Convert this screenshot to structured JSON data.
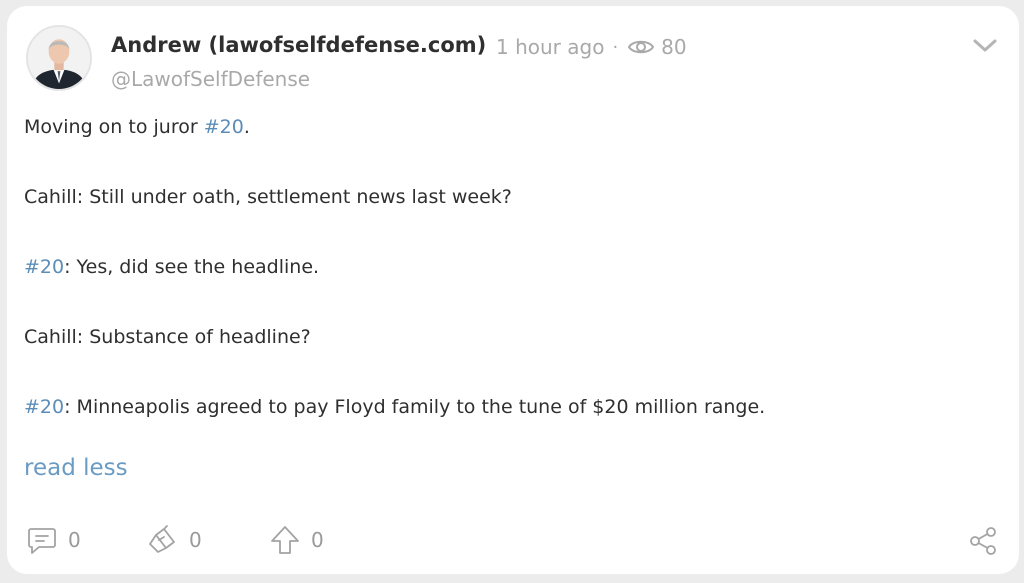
{
  "post": {
    "author_name": "Andrew (lawofselfdefense.com)",
    "time_ago": "1 hour ago",
    "dot": "·",
    "views": "80",
    "handle": "@LawofSelfDefense",
    "paragraphs": [
      {
        "pre": "Moving on to juror ",
        "tag": "#20",
        "post": "."
      },
      {
        "pre": "Cahill: Still under oath, settlement news last week?",
        "tag": "",
        "post": ""
      },
      {
        "pre": "",
        "tag": "#20",
        "post": ": Yes, did see the headline."
      },
      {
        "pre": "Cahill: Substance of headline?",
        "tag": "",
        "post": ""
      },
      {
        "pre": "",
        "tag": "#20",
        "post": ": Minneapolis agreed to pay Floyd family to the tune of $20 million range."
      }
    ],
    "read_less": "read less"
  },
  "actions": {
    "comments": "0",
    "tips": "0",
    "upvotes": "0"
  },
  "icons": {
    "eye": "eye-icon",
    "chevron": "chevron-down-icon",
    "comment": "comment-icon",
    "tip": "tip-icon",
    "upvote": "upvote-arrow-icon",
    "share": "share-icon"
  },
  "colors": {
    "hashtag": "#5b8db8",
    "link": "#6a9bc3",
    "muted": "#a9a9a9",
    "text": "#2f2f2f",
    "background": "#ececec",
    "card": "#ffffff"
  }
}
